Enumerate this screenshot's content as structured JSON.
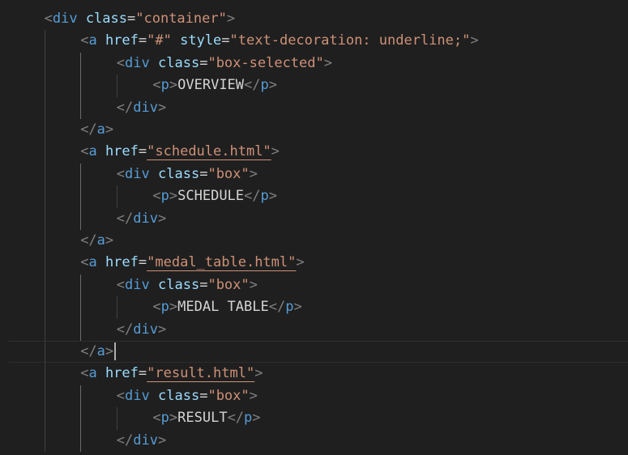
{
  "editor": {
    "lines": [
      {
        "indent": 1,
        "parts": [
          [
            "punct",
            "<"
          ],
          [
            "tag",
            "div"
          ],
          [
            "text",
            " "
          ],
          [
            "attr",
            "class"
          ],
          [
            "text",
            "="
          ],
          [
            "val",
            "\"container\""
          ],
          [
            "punct",
            ">"
          ]
        ]
      },
      {
        "indent": 2,
        "parts": [
          [
            "punct",
            "<"
          ],
          [
            "tag",
            "a"
          ],
          [
            "text",
            " "
          ],
          [
            "attr",
            "href"
          ],
          [
            "text",
            "="
          ],
          [
            "val",
            "\"#\""
          ],
          [
            "text",
            " "
          ],
          [
            "attr",
            "style"
          ],
          [
            "text",
            "="
          ],
          [
            "val",
            "\"text-decoration: underline;\""
          ],
          [
            "punct",
            ">"
          ]
        ]
      },
      {
        "indent": 3,
        "parts": [
          [
            "punct",
            "<"
          ],
          [
            "tag",
            "div"
          ],
          [
            "text",
            " "
          ],
          [
            "attr",
            "class"
          ],
          [
            "text",
            "="
          ],
          [
            "val",
            "\"box-selected\""
          ],
          [
            "punct",
            ">"
          ]
        ]
      },
      {
        "indent": 4,
        "parts": [
          [
            "punct",
            "<"
          ],
          [
            "tag",
            "p"
          ],
          [
            "punct",
            ">"
          ],
          [
            "text",
            "OVERVIEW"
          ],
          [
            "punct",
            "</"
          ],
          [
            "tag",
            "p"
          ],
          [
            "punct",
            ">"
          ]
        ]
      },
      {
        "indent": 3,
        "parts": [
          [
            "punct",
            "</"
          ],
          [
            "tag",
            "div"
          ],
          [
            "punct",
            ">"
          ]
        ]
      },
      {
        "indent": 2,
        "parts": [
          [
            "punct",
            "</"
          ],
          [
            "tag",
            "a"
          ],
          [
            "punct",
            ">"
          ]
        ]
      },
      {
        "indent": 2,
        "parts": [
          [
            "punct",
            "<"
          ],
          [
            "tag",
            "a"
          ],
          [
            "text",
            " "
          ],
          [
            "attr",
            "href"
          ],
          [
            "text",
            "="
          ],
          [
            "val",
            "\"schedule.html\"",
            "spell"
          ],
          [
            "punct",
            ">"
          ]
        ]
      },
      {
        "indent": 3,
        "parts": [
          [
            "punct",
            "<"
          ],
          [
            "tag",
            "div"
          ],
          [
            "text",
            " "
          ],
          [
            "attr",
            "class"
          ],
          [
            "text",
            "="
          ],
          [
            "val",
            "\"box\""
          ],
          [
            "punct",
            ">"
          ]
        ]
      },
      {
        "indent": 4,
        "parts": [
          [
            "punct",
            "<"
          ],
          [
            "tag",
            "p"
          ],
          [
            "punct",
            ">"
          ],
          [
            "text",
            "SCHEDULE"
          ],
          [
            "punct",
            "</"
          ],
          [
            "tag",
            "p"
          ],
          [
            "punct",
            ">"
          ]
        ]
      },
      {
        "indent": 3,
        "parts": [
          [
            "punct",
            "</"
          ],
          [
            "tag",
            "div"
          ],
          [
            "punct",
            ">"
          ]
        ]
      },
      {
        "indent": 2,
        "parts": [
          [
            "punct",
            "</"
          ],
          [
            "tag",
            "a"
          ],
          [
            "punct",
            ">"
          ]
        ]
      },
      {
        "indent": 2,
        "parts": [
          [
            "punct",
            "<"
          ],
          [
            "tag",
            "a"
          ],
          [
            "text",
            " "
          ],
          [
            "attr",
            "href"
          ],
          [
            "text",
            "="
          ],
          [
            "val",
            "\"medal_table.html\"",
            "spell"
          ],
          [
            "punct",
            ">"
          ]
        ]
      },
      {
        "indent": 3,
        "parts": [
          [
            "punct",
            "<"
          ],
          [
            "tag",
            "div"
          ],
          [
            "text",
            " "
          ],
          [
            "attr",
            "class"
          ],
          [
            "text",
            "="
          ],
          [
            "val",
            "\"box\""
          ],
          [
            "punct",
            ">"
          ]
        ]
      },
      {
        "indent": 4,
        "parts": [
          [
            "punct",
            "<"
          ],
          [
            "tag",
            "p"
          ],
          [
            "punct",
            ">"
          ],
          [
            "text",
            "MEDAL TABLE"
          ],
          [
            "punct",
            "</"
          ],
          [
            "tag",
            "p"
          ],
          [
            "punct",
            ">"
          ]
        ]
      },
      {
        "indent": 3,
        "parts": [
          [
            "punct",
            "</"
          ],
          [
            "tag",
            "div"
          ],
          [
            "punct",
            ">"
          ]
        ]
      },
      {
        "indent": 2,
        "parts": [
          [
            "punct",
            "</"
          ],
          [
            "tag",
            "a"
          ],
          [
            "punct",
            ">"
          ]
        ],
        "current": true,
        "cursor": true
      },
      {
        "indent": 2,
        "parts": [
          [
            "punct",
            "<"
          ],
          [
            "tag",
            "a"
          ],
          [
            "text",
            " "
          ],
          [
            "attr",
            "href"
          ],
          [
            "text",
            "="
          ],
          [
            "val",
            "\"result.html\"",
            "spell"
          ],
          [
            "punct",
            ">"
          ]
        ]
      },
      {
        "indent": 3,
        "parts": [
          [
            "punct",
            "<"
          ],
          [
            "tag",
            "div"
          ],
          [
            "text",
            " "
          ],
          [
            "attr",
            "class"
          ],
          [
            "text",
            "="
          ],
          [
            "val",
            "\"box\""
          ],
          [
            "punct",
            ">"
          ]
        ]
      },
      {
        "indent": 4,
        "parts": [
          [
            "punct",
            "<"
          ],
          [
            "tag",
            "p"
          ],
          [
            "punct",
            ">"
          ],
          [
            "text",
            "RESULT"
          ],
          [
            "punct",
            "</"
          ],
          [
            "tag",
            "p"
          ],
          [
            "punct",
            ">"
          ]
        ]
      },
      {
        "indent": 3,
        "parts": [
          [
            "punct",
            "</"
          ],
          [
            "tag",
            "div"
          ],
          [
            "punct",
            ">"
          ]
        ]
      }
    ]
  }
}
